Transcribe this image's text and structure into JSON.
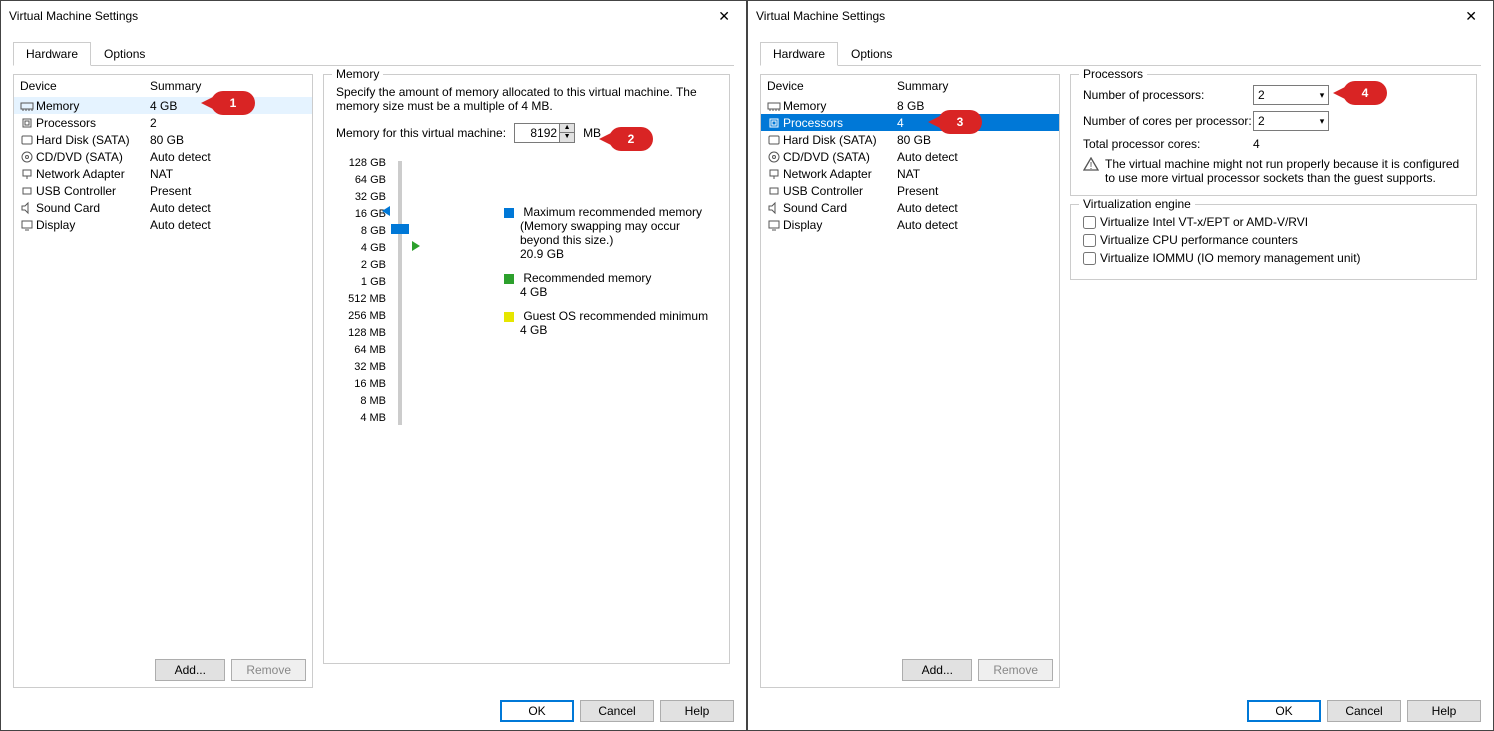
{
  "left": {
    "title": "Virtual Machine Settings",
    "tabs": {
      "hardware": "Hardware",
      "options": "Options"
    },
    "columns": {
      "device": "Device",
      "summary": "Summary"
    },
    "devices": [
      {
        "name": "Memory",
        "summary": "4 GB",
        "icon": "memory",
        "sel": true
      },
      {
        "name": "Processors",
        "summary": "2",
        "icon": "cpu"
      },
      {
        "name": "Hard Disk (SATA)",
        "summary": "80 GB",
        "icon": "disk"
      },
      {
        "name": "CD/DVD (SATA)",
        "summary": "Auto detect",
        "icon": "cd"
      },
      {
        "name": "Network Adapter",
        "summary": "NAT",
        "icon": "net"
      },
      {
        "name": "USB Controller",
        "summary": "Present",
        "icon": "usb"
      },
      {
        "name": "Sound Card",
        "summary": "Auto detect",
        "icon": "sound"
      },
      {
        "name": "Display",
        "summary": "Auto detect",
        "icon": "display"
      }
    ],
    "btn_add": "Add...",
    "btn_remove": "Remove",
    "mem": {
      "legend": "Memory",
      "desc": "Specify the amount of memory allocated to this virtual machine. The memory size must be a multiple of 4 MB.",
      "label": "Memory for this virtual machine:",
      "value": "8192",
      "unit": "MB",
      "ticks": [
        "128 GB",
        "64 GB",
        "32 GB",
        "16 GB",
        "8 GB",
        "4 GB",
        "2 GB",
        "1 GB",
        "512 MB",
        "256 MB",
        "128 MB",
        "64 MB",
        "32 MB",
        "16 MB",
        "8 MB",
        "4 MB"
      ],
      "max_label": "Maximum recommended memory",
      "max_note": "(Memory swapping may occur beyond this size.)",
      "max_val": "20.9 GB",
      "rec_label": "Recommended memory",
      "rec_val": "4 GB",
      "min_label": "Guest OS recommended minimum",
      "min_val": "4 GB"
    },
    "footer": {
      "ok": "OK",
      "cancel": "Cancel",
      "help": "Help"
    }
  },
  "right": {
    "title": "Virtual Machine Settings",
    "tabs": {
      "hardware": "Hardware",
      "options": "Options"
    },
    "columns": {
      "device": "Device",
      "summary": "Summary"
    },
    "devices": [
      {
        "name": "Memory",
        "summary": "8 GB",
        "icon": "memory"
      },
      {
        "name": "Processors",
        "summary": "4",
        "icon": "cpu",
        "selblue": true
      },
      {
        "name": "Hard Disk (SATA)",
        "summary": "80 GB",
        "icon": "disk"
      },
      {
        "name": "CD/DVD (SATA)",
        "summary": "Auto detect",
        "icon": "cd"
      },
      {
        "name": "Network Adapter",
        "summary": "NAT",
        "icon": "net"
      },
      {
        "name": "USB Controller",
        "summary": "Present",
        "icon": "usb"
      },
      {
        "name": "Sound Card",
        "summary": "Auto detect",
        "icon": "sound"
      },
      {
        "name": "Display",
        "summary": "Auto detect",
        "icon": "display"
      }
    ],
    "btn_add": "Add...",
    "btn_remove": "Remove",
    "proc": {
      "legend": "Processors",
      "num_proc_label": "Number of processors:",
      "num_proc_val": "2",
      "num_cores_label": "Number of cores per processor:",
      "num_cores_val": "2",
      "total_label": "Total processor cores:",
      "total_val": "4",
      "warning": "The virtual machine might not run properly because it is configured to use more virtual processor sockets than the guest supports."
    },
    "virt": {
      "legend": "Virtualization engine",
      "chk1": "Virtualize Intel VT-x/EPT or AMD-V/RVI",
      "chk2": "Virtualize CPU performance counters",
      "chk3": "Virtualize IOMMU (IO memory management unit)"
    },
    "footer": {
      "ok": "OK",
      "cancel": "Cancel",
      "help": "Help"
    }
  },
  "callouts": {
    "c1": "1",
    "c2": "2",
    "c3": "3",
    "c4": "4"
  }
}
